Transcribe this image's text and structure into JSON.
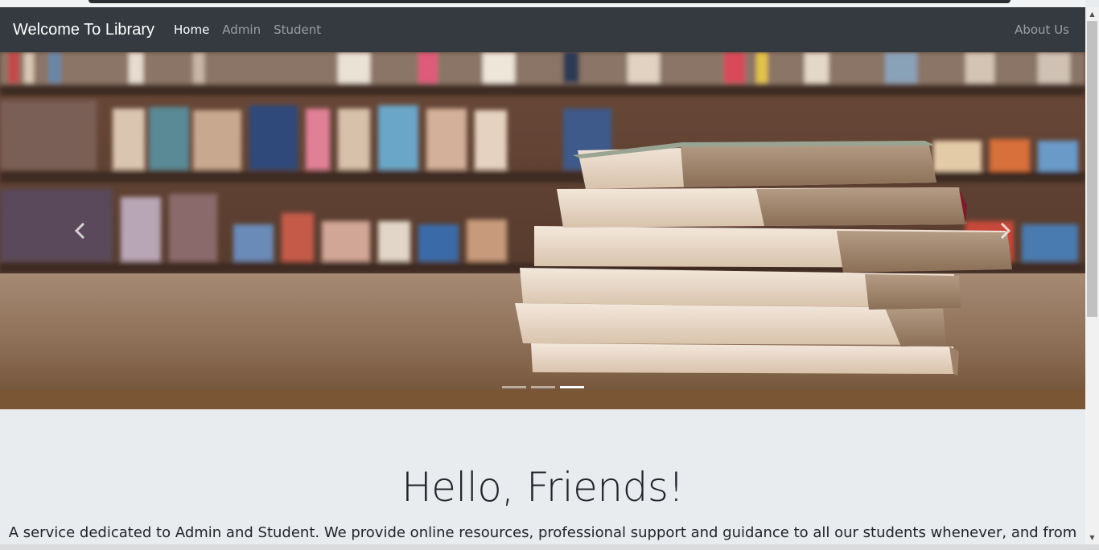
{
  "navbar": {
    "brand": "Welcome To Library",
    "links": [
      {
        "label": "Home",
        "active": true
      },
      {
        "label": "Admin",
        "active": false
      },
      {
        "label": "Student",
        "active": false
      }
    ],
    "right_link": "About Us"
  },
  "carousel": {
    "prev_icon": "chevron-left-icon",
    "next_icon": "chevron-right-icon",
    "slide_count": 3,
    "active_slide": 3
  },
  "jumbotron": {
    "heading": "Hello, Friends!",
    "lead": "A service dedicated to Admin and Student. We provide online resources, professional support and guidance to all our students whenever, and from"
  },
  "colors": {
    "navbar_bg": "#343a40",
    "page_bg": "#e9ecef",
    "text": "#212529"
  }
}
